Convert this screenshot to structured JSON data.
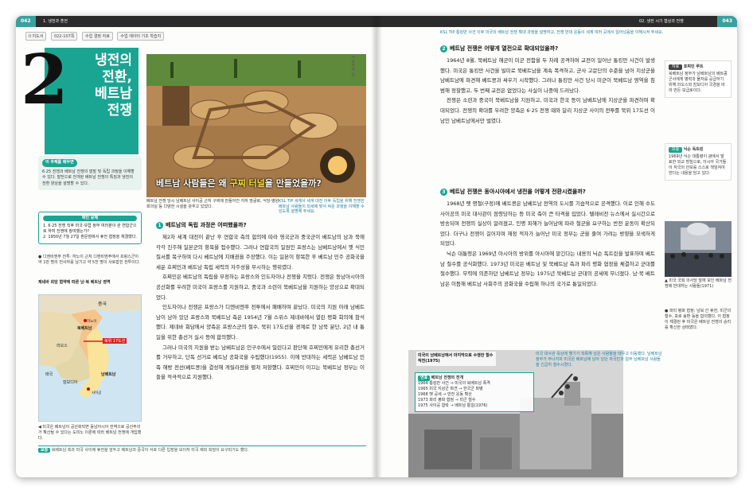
{
  "left": {
    "page_number": "042",
    "header_title": "1. 냉전과 혼전",
    "chips": [
      "II 지도서",
      "022-107쪽",
      "수업 결정 자료",
      "수업 에이터 기초 학습지"
    ],
    "chapter_number": "2",
    "chapter_title": "냉전의\n전환,\n베트남\n전쟁",
    "learn_tag": "이 주제를 배우면",
    "learn_text": "6·25 전쟁과 베트남 전쟁의 발발 및 독립 과정을 이해할 수 있다. 발전으로 전개된 베트남 전쟁의 특징과 냉전의 전환 양상을 설명할 수 있다.",
    "check_title": "확인 문제",
    "check_items": [
      "1. 6·25 전쟁 직후 미국·유럽 정부 여러분이 관 연합군으로 하여 전쟁에 참여했는가?",
      "2. 1950년 7월 27일 판문점에서 휴전 협정을 체결했다."
    ],
    "term_note": "● 디엔비엔푸 전투: 하노이 근처 디엔비엔푸에서 프랑스군이 약 1만 명의 전사자를 남기고 약 5천 명이 사로잡힌 전투이다.",
    "map_title": "제네바 회담 협약에 따른 남·북 베트남 영역",
    "map_labels": {
      "china": "중국",
      "north": "북베트남",
      "south": "남베트남",
      "laos": "라오스",
      "cambodia": "캄보디아",
      "thailand": "태국",
      "line": "북위 17도선",
      "hanoi": "하노이",
      "saigon": "사이공"
    },
    "map_caption": "◀ 미국은 베트남이 공산화되면 동남아시아 전역으로 공산주의가 확산될 수 있다는 도미노 이론에 따라 베트남 전쟁에 개입했다.",
    "hero_caption_prefix": "베트남 사람들은 왜 ",
    "hero_caption_highlight": "구찌 터널",
    "hero_caption_suffix": "을 만들었을까?",
    "hero_sub": "베트남 전쟁 당시 남베트남 사이공 근처 구찌에 만들어진 지하 땅굴로, 식당·병원·회의실 등 다양한 시설을 갖추고 있었다.",
    "ksl_note": "KSL TIP 세계사 세계 대전 이후 독립을 위해 전쟁한 베트남 사람들이 외세에 맞서 싸운 과정을 이해할 수 있도록 설명해 주세요.",
    "side_label": "2 교과서 쪽",
    "section1_num": "1",
    "section1_title": "베트남의 독립 과정은 어떠했을까?",
    "section1_body": [
      "제2차 세계 대전이 끝난 후 연합국 측의 합의에 따라 영국군과 중국군이 베트남의 남과 북에 각각 진주해 일본군의 항복을 접수했다. 그러나 연합국의 일원인 프랑스는 남베트남에서 옛 식민 질서를 복구하며 다시 베트남에 지배권을 주장했다. 이는 일본이 항복한 후 베트남 민주 공화국을 세운 호찌민과 베트남 독립 세력의 자주성을 무시하는 행위였다.",
      "호찌민은 베트남의 독립을 부정하는 프랑스와 인도차이나 전쟁을 치렀다. 전쟁은 동남아시아의 공산화를 우려한 미국이 프랑스를 지원하고, 중국과 소련이 북베트남을 지원하는 양상으로 확대되었다.",
      "인도차이나 전쟁은 프랑스가 디엔비엔푸 전투에서 패배하며 끝났다. 미국의 지원 아래 남베트남이 남아 있던 프랑스와 북베트남 측은 1954년 7월 스위스 제네바에서 열린 평화 회의에 참석했다. 제네바 회담에서 양측은 프랑스군의 철수, 북위 17도선을 경계로 한 남북 분단, 2년 내 통일을 위한 총선거 실시 등에 합의했다.",
      "그러나 미국의 지원을 받는 남베트남은 인구수에서 밀린다고 판단해 호찌민에게 유리한 총선거를 거부하고, 단독 선거로 베트남 공화국을 수립했다(1955). 이에 반대하는 세력은 남베트남 민족 해방 전선(베트콩)을 결성해 게릴라전을 펼쳐 저항했다. 호찌민이 이끄는 북베트남 정부는 이들을 적극적으로 지원했다."
    ],
    "bottom_tag": "보충",
    "bottom_note": "북베트남 측과 미국 사이에 휴전을 앞두고 베트남과 중국이 서로 다른 입장을 보이자 미국 제외 회담이 요구되기도 했다."
  },
  "right": {
    "page_number": "043",
    "header_title": "02. 냉전 시기 협상과 전쟁",
    "ksl_note": "KSL TIP 통킹만 사건 이후 미국의 베트남 전쟁 확대 과정을 설명하고, 전쟁 반대 운동이 세계 여러 곳에서 일어났음을 이해시켜 주세요.",
    "section2_num": "2",
    "section2_title": "베트남 전쟁은 어떻게 열전으로 확대되었을까?",
    "section2_body": [
      "1964년 8월, 북베트남 해군이 미군 전함을 두 차례 공격하며 교전이 일어난 통킹만 사건이 발생했다. 미국은 통킹만 사건을 빌미로 북베트남을 계속 폭격하고, 군사 고문단의 수준을 넘어 지상군을 남베트남에 파견해 베트콩과 싸우기 시작했다. 그러나 통킹만 사건 당시 미군이 북베트남 영역을 침범해 정찰했고, 두 번째 교전은 없었다는 사실이 나중에 드러났다.",
      "전쟁은 소련과 중국이 북베트남을 지원하고, 미국과 한국 등이 남베트남에 지상군을 파견하며 확대되었다. 전쟁의 확대를 우려한 양측은 6·25 전쟁 때와 달리 지상군 사이의 전투를 북위 17도선 이남인 남베트남에서만 벌였다."
    ],
    "section3_num": "3",
    "section3_title": "베트남 전쟁은 동아시아에서 냉전을 어떻게 전환시켰을까?",
    "section3_body": [
      "1968년 뗏 명절(구정)에 베트콩은 남베트남 전역의 도시를 기습적으로 공격했다. 이로 인해 수도 사이공의 미국 대사관이 점령당하는 등 미국 측이 큰 타격을 입었다. 텔레비전 뉴스에서 실시간으로 방송되며 전쟁의 실상이 알려졌고, 인명 피해가 늘어남에 따라 철군을 요구하는 반전 운동이 확산되었다. 더구나 전쟁이 길어지며 재정 적자가 늘어난 미국 정부는 군을 줄여 가려는 방향을 모색하게 되었다.",
      "닉슨 대통령은 1969년 아시아의 방위를 아시아에 맡긴다는 내용의 닉슨 독트린을 발표하며 베트남 철수를 공식화했다. 1973년 미국은 베트남 및 북베트남 측과 파리 평화 협정을 체결하고 군대를 철수했다. 무력에 의존하던 남베트남 정부는 1975년 북베트남 군대의 공세에 무너졌다. 남·북 베트남은 이듬해 베트남 사회주의 공화국을 수립해 하나의 국가로 통일되었다."
    ],
    "side1_tag": "자료",
    "side1_title": "호찌민 루트",
    "side1_text": "북베트남 정부가 남베트남의 베트콩 군사에게 병력과 물자를 공급하기 위해 라오스와 캄보디아 국경을 따라 만든 보급로이다.",
    "side2_tag": "보충",
    "side2_title": "닉슨 독트린",
    "side2_text": "1969년 닉슨 대통령이 괌에서 발표한 외교 방침으로, 아시아 국가들이 자국의 안보를 스스로 책임져야 한다는 내용을 담고 있다.",
    "photo_caption": "▲ 미국 국회 의사당 앞에 모인 베트남 전쟁에 반대하는 사람들(1971)",
    "side3_text": "● 파리 평화 협정: 남북 간 휴전, 미군의 철수, 포로 송환 등을 합의했다. 이 협정이 체결된 후 미국은 베트남 전쟁의 승리를 확신한 상태였다.",
    "bw_caption": "미국이 남베트남에서 마지막으로 수행한 철수 작전(1975)",
    "bw_side_text": "미국 대사관 옥상에 헬기가 착륙해 남은 사람들을 태우고 이동했다. 남베트남 정부가 무너지자 미국은 베트남에 남아 있던 자국민과 일부 남베트남 사람들을 긴급히 철수시켰다.",
    "timeline_tag": "연표",
    "timeline_title": "베트남 전쟁의 전개",
    "timeline_items": [
      "1964 통킹만 사건 → 미국의 북베트남 폭격",
      "1965 미국 지상군 파견 → 한국군 파병",
      "1968 뗏 공세 → 반전 운동 확산",
      "1973 파리 평화 협정 → 미군 철수",
      "1975 사이공 함락 → 베트남 통일(1976)"
    ]
  },
  "colors": {
    "accent": "#1aa592",
    "tip": "#1a7fa0",
    "header": "#2b2b2b"
  }
}
